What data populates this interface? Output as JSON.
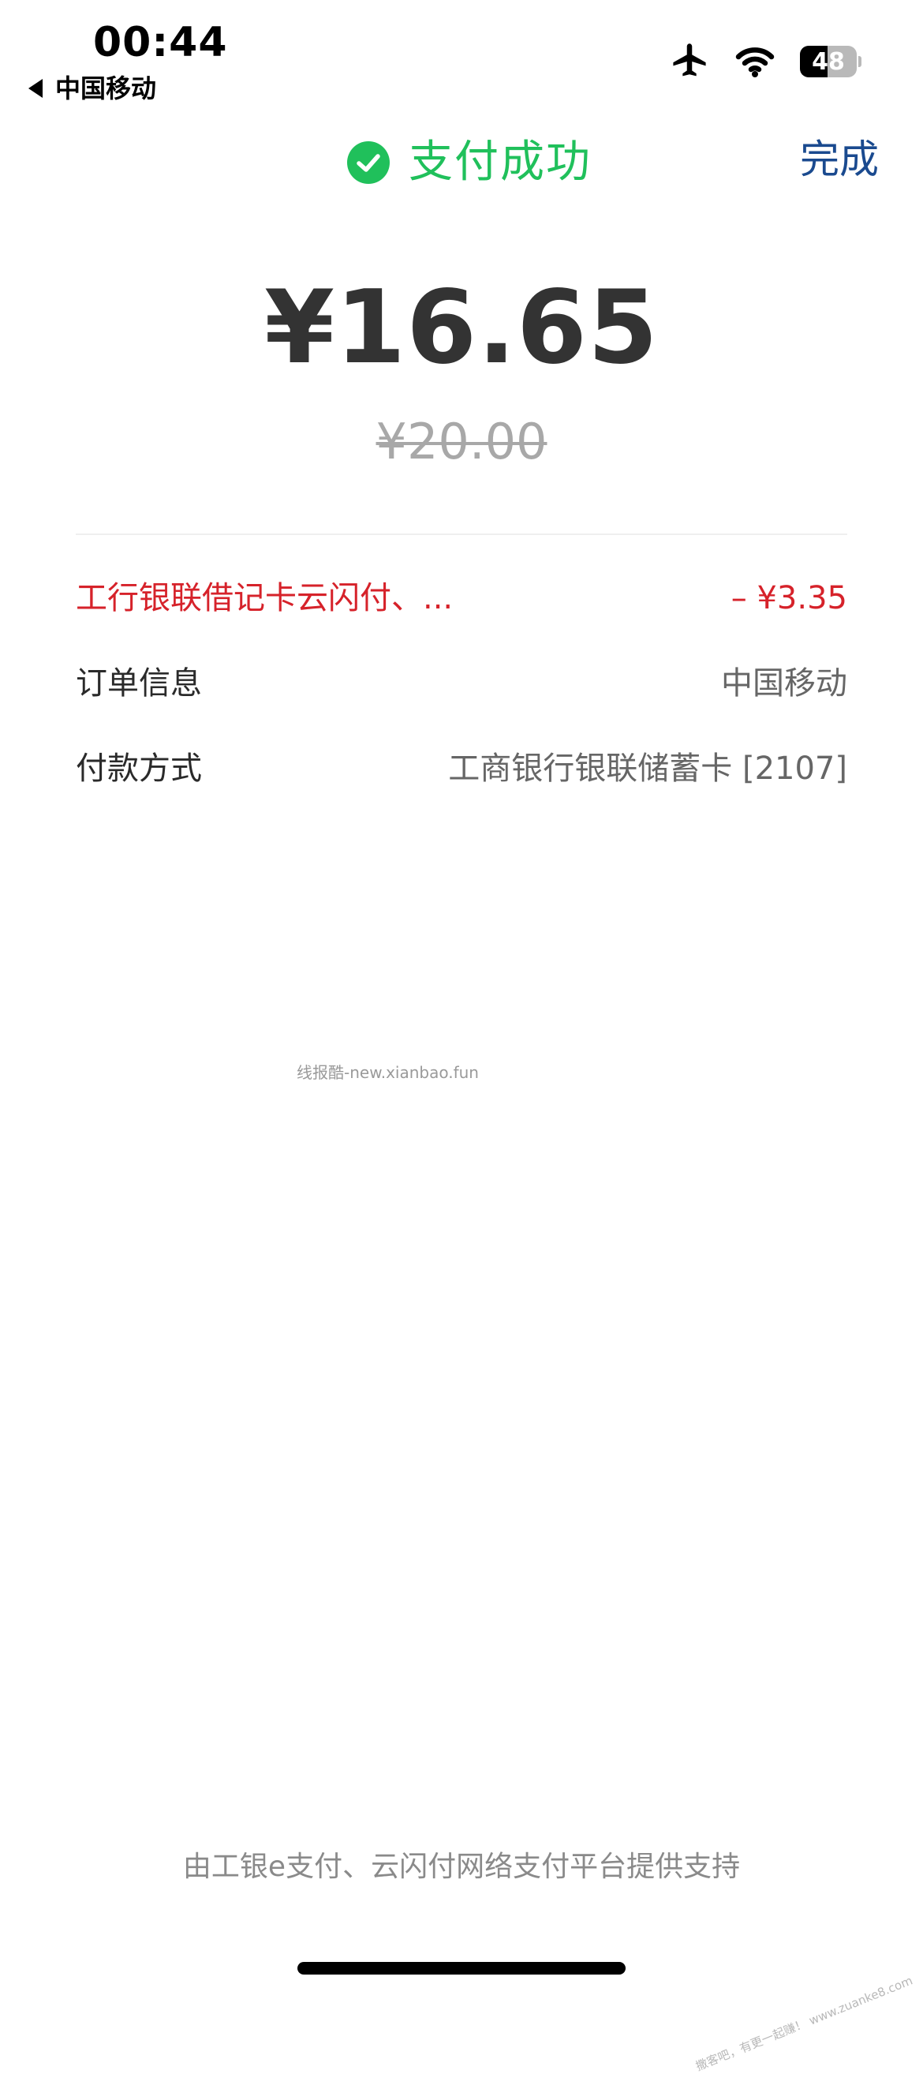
{
  "status_bar": {
    "time": "00:44",
    "back_label": "中国移动",
    "battery_level": "48",
    "battery_fraction": 0.48,
    "icons": [
      "airplane-icon",
      "wifi-icon",
      "battery-icon"
    ]
  },
  "header": {
    "title": "支付成功",
    "done_label": "完成",
    "icon": "check-circle-icon"
  },
  "payment": {
    "amount": "¥16.65",
    "original_amount": "¥20.00"
  },
  "details": {
    "discount": {
      "label": "工行银联借记卡云闪付、...",
      "value": "– ¥3.35"
    },
    "order": {
      "label": "订单信息",
      "value": "中国移动"
    },
    "method": {
      "label": "付款方式",
      "value": "工商银行银联储蓄卡 [2107]"
    }
  },
  "watermark": {
    "text": "线报酷-new.xianbao.fun",
    "corner_text": "撒客吧，有更一起赚！ www.zuanke8.com"
  },
  "footer": {
    "note": "由工银e支付、云闪付网络支付平台提供支持"
  },
  "colors": {
    "success_green": "#20c05b",
    "link_blue": "#1a4a8f",
    "discount_red": "#d6222a",
    "amount_dark": "#333333"
  }
}
